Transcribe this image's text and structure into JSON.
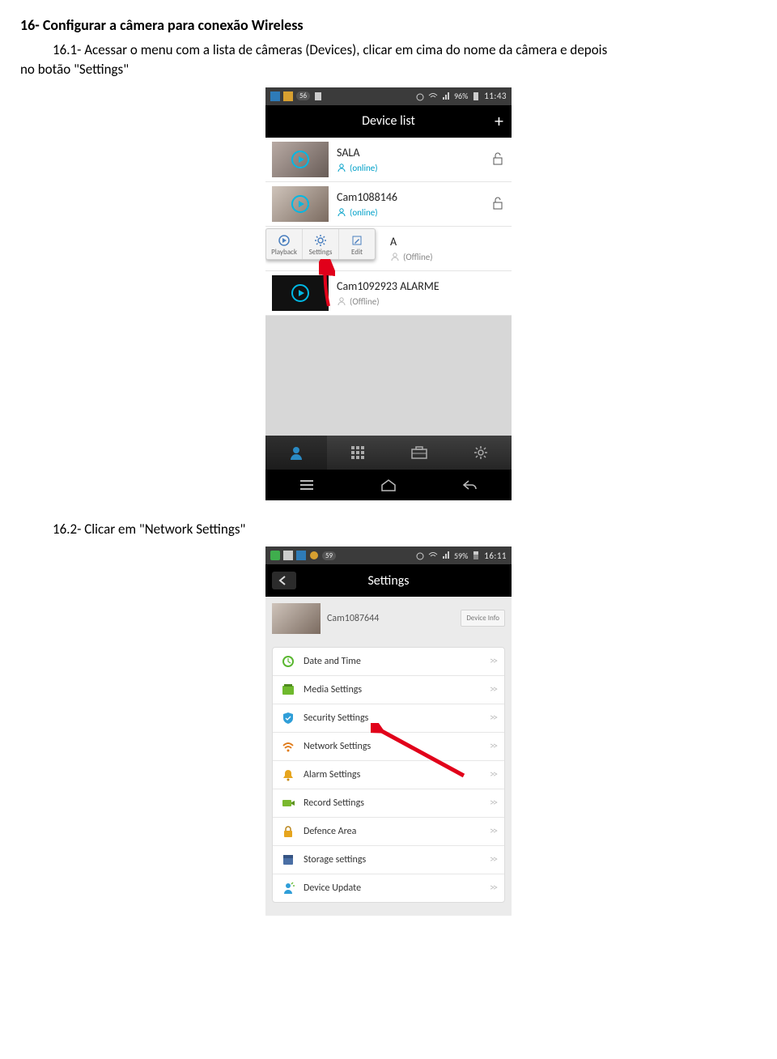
{
  "doc": {
    "heading16": "16- Configurar a câmera para conexão Wireless",
    "para161a": "16.1- Acessar o menu com a lista de câmeras (Devices), clicar em cima do nome da câmera e depois",
    "para161b": "no botão \"Settings\"",
    "para162": "16.2- Clicar em \"Network Settings\""
  },
  "phone1": {
    "status_badge": "56",
    "battery": "96%",
    "time": "11:43",
    "title": "Device list",
    "plus": "+",
    "devices": [
      {
        "name": "SALA",
        "status": "(online)",
        "online": true
      },
      {
        "name": "Cam1088146",
        "status": "(online)",
        "online": true
      },
      {
        "name": "A",
        "status": "(Offline)",
        "online": false
      },
      {
        "name": "Cam1092923 ALARME",
        "status": "(Offline)",
        "online": false
      }
    ],
    "ctx": {
      "playback": "Playback",
      "settings": "Settings",
      "edit": "Edit"
    }
  },
  "phone2": {
    "status_badge": "59",
    "battery": "59%",
    "time": "16:11",
    "title": "Settings",
    "camera_name": "Cam1087644",
    "device_info": "Device Info",
    "items": [
      {
        "label": "Date and Time",
        "icon": "clock",
        "color": "#5ab731"
      },
      {
        "label": "Media Settings",
        "icon": "media",
        "color": "#6fb92d"
      },
      {
        "label": "Security Settings",
        "icon": "shield",
        "color": "#2f9ed8"
      },
      {
        "label": "Network Settings",
        "icon": "wifi",
        "color": "#e07b1a"
      },
      {
        "label": "Alarm Settings",
        "icon": "bell",
        "color": "#e6a51e"
      },
      {
        "label": "Record Settings",
        "icon": "record",
        "color": "#7ab82e"
      },
      {
        "label": "Defence Area",
        "icon": "lock",
        "color": "#e6a51e"
      },
      {
        "label": "Storage settings",
        "icon": "storage",
        "color": "#4a6fa5"
      },
      {
        "label": "Device Update",
        "icon": "update",
        "color": "#2f9ed8"
      }
    ]
  }
}
